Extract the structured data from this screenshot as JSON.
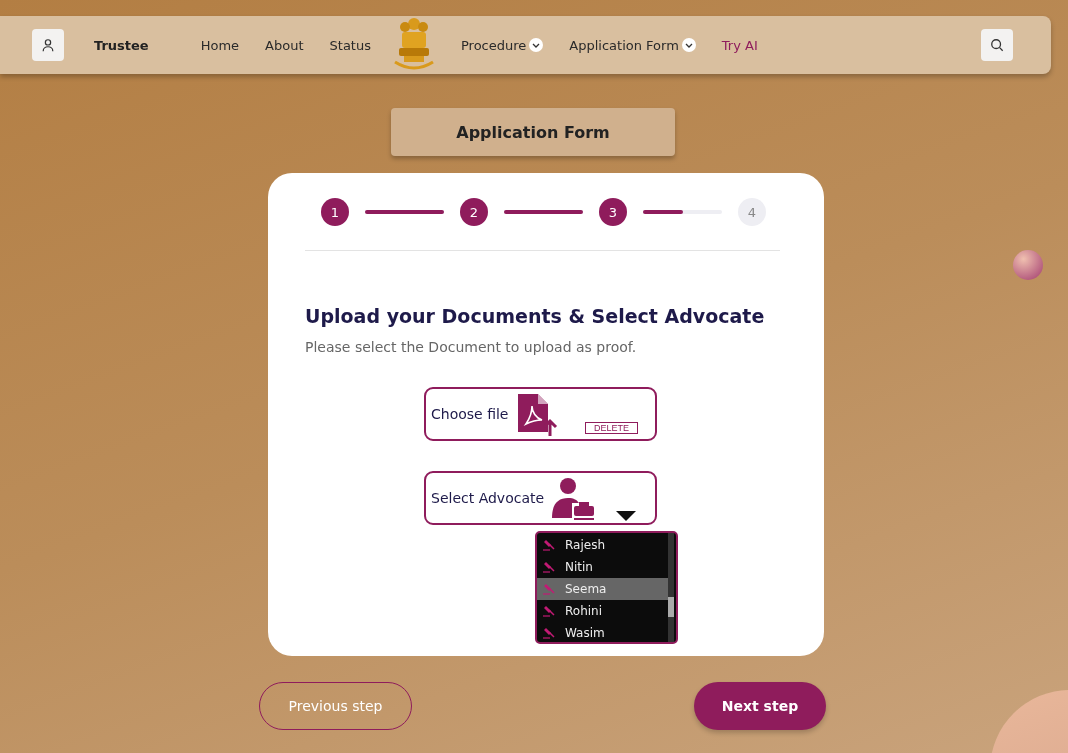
{
  "nav": {
    "brand": "Trustee",
    "links": [
      {
        "label": "Home",
        "kind": "plain"
      },
      {
        "label": "About",
        "kind": "plain"
      },
      {
        "label": "Status",
        "kind": "plain"
      },
      {
        "kind": "emblem"
      },
      {
        "label": "Procedure",
        "kind": "dropdown"
      },
      {
        "label": "Application Form",
        "kind": "dropdown"
      },
      {
        "label": "Try AI",
        "kind": "accent"
      }
    ]
  },
  "page_title": "Application Form",
  "steps": [
    {
      "label": "1",
      "done": true,
      "level": 1
    },
    {
      "label": "2",
      "done": true,
      "level": 1
    },
    {
      "label": "3",
      "done": true,
      "level": 0.5
    },
    {
      "label": "4",
      "done": false
    }
  ],
  "heading": "Upload your Documents & Select Advocate",
  "subtitle": "Please select the Document to upload as proof.",
  "upload": {
    "label": "Choose file",
    "delete": "DELETE"
  },
  "advocate": {
    "label": "Select Advocate",
    "expanded": true,
    "options": [
      {
        "name": "Rajesh",
        "selected": false
      },
      {
        "name": "Nitin",
        "selected": false
      },
      {
        "name": "Seema",
        "selected": true
      },
      {
        "name": "Rohini",
        "selected": false
      },
      {
        "name": "Wasim",
        "selected": false
      }
    ]
  },
  "buttons": {
    "previous": "Previous step",
    "next": "Next step"
  }
}
